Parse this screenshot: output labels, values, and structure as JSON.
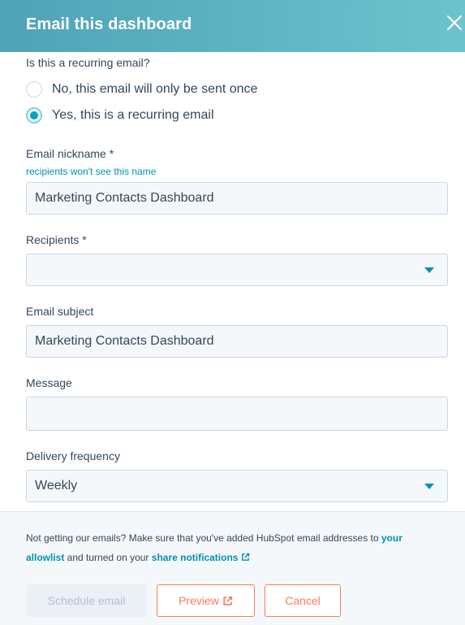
{
  "header": {
    "title": "Email this dashboard"
  },
  "recurring": {
    "question": "Is this a recurring email?",
    "options": [
      {
        "label": "No, this email will only be sent once",
        "selected": false
      },
      {
        "label": "Yes, this is a recurring email",
        "selected": true
      }
    ]
  },
  "nickname": {
    "label": "Email nickname *",
    "hint": "recipients won't see this name",
    "value": "Marketing Contacts Dashboard"
  },
  "recipients": {
    "label": "Recipients *",
    "value": ""
  },
  "subject": {
    "label": "Email subject",
    "value": "Marketing Contacts Dashboard"
  },
  "message": {
    "label": "Message",
    "value": ""
  },
  "frequency": {
    "label": "Delivery frequency",
    "value": "Weekly"
  },
  "footer": {
    "text_1": "Not getting our emails? Make sure that you've added HubSpot email addresses to ",
    "link_1": "your allowlist",
    "text_2": " and turned on your ",
    "link_2": "share notifications"
  },
  "buttons": {
    "schedule": "Schedule email",
    "preview": "Preview",
    "cancel": "Cancel"
  },
  "colors": {
    "accent": "#00a4bd",
    "link": "#0091ae",
    "cta": "#ff7a59",
    "header_from": "#4fa3b6",
    "header_to": "#6cc3cd"
  },
  "icons": {
    "close": "close-icon",
    "external_link": "external-link-icon",
    "dropdown": "chevron-down-icon"
  }
}
